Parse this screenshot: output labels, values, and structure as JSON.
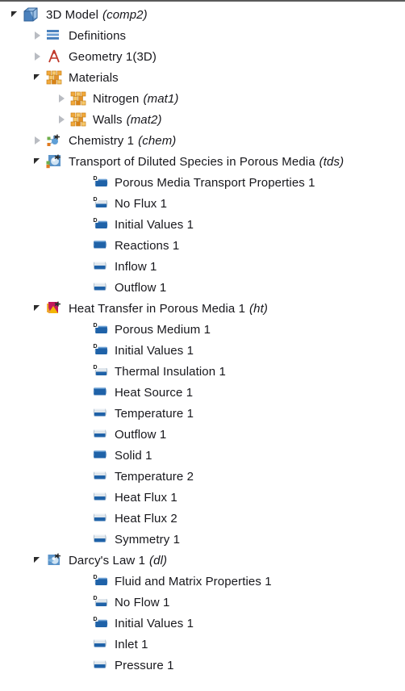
{
  "tree": {
    "title": "3D Model",
    "rows": [
      {
        "label": "3D Model",
        "tag": "(comp2)",
        "indent": 0,
        "expander": "open",
        "icon": "cube-3d-icon"
      },
      {
        "label": "Definitions",
        "tag": "",
        "indent": 1,
        "expander": "closed",
        "icon": "definitions-icon"
      },
      {
        "label": "Geometry 1(3D)",
        "tag": "",
        "indent": 1,
        "expander": "closed",
        "icon": "geometry-compass-icon"
      },
      {
        "label": "Materials",
        "tag": "",
        "indent": 1,
        "expander": "open",
        "icon": "materials-grid-icon"
      },
      {
        "label": "Nitrogen",
        "tag": "(mat1)",
        "indent": 2,
        "expander": "closed",
        "icon": "material-grid-icon"
      },
      {
        "label": "Walls",
        "tag": "(mat2)",
        "indent": 2,
        "expander": "closed",
        "icon": "material-grid-icon"
      },
      {
        "label": "Chemistry 1",
        "tag": "(chem)",
        "indent": 1,
        "expander": "closed",
        "icon": "chemistry-icon"
      },
      {
        "label": "Transport of Diluted Species in Porous Media",
        "tag": "(tds)",
        "indent": 1,
        "expander": "open",
        "icon": "tds-physics-icon"
      },
      {
        "label": "Porous Media Transport Properties 1",
        "tag": "",
        "indent": 3,
        "expander": "none",
        "icon": "domain-default-icon"
      },
      {
        "label": "No Flux 1",
        "tag": "",
        "indent": 3,
        "expander": "none",
        "icon": "boundary-default-icon"
      },
      {
        "label": "Initial Values 1",
        "tag": "",
        "indent": 3,
        "expander": "none",
        "icon": "domain-default-icon"
      },
      {
        "label": "Reactions 1",
        "tag": "",
        "indent": 3,
        "expander": "none",
        "icon": "domain-icon"
      },
      {
        "label": "Inflow 1",
        "tag": "",
        "indent": 3,
        "expander": "none",
        "icon": "boundary-icon"
      },
      {
        "label": "Outflow 1",
        "tag": "",
        "indent": 3,
        "expander": "none",
        "icon": "boundary-icon"
      },
      {
        "label": "Heat Transfer in Porous Media 1",
        "tag": "(ht)",
        "indent": 1,
        "expander": "open",
        "icon": "heat-transfer-icon"
      },
      {
        "label": "Porous Medium 1",
        "tag": "",
        "indent": 3,
        "expander": "none",
        "icon": "domain-default-icon"
      },
      {
        "label": "Initial Values 1",
        "tag": "",
        "indent": 3,
        "expander": "none",
        "icon": "domain-default-icon"
      },
      {
        "label": "Thermal Insulation 1",
        "tag": "",
        "indent": 3,
        "expander": "none",
        "icon": "boundary-default-icon"
      },
      {
        "label": "Heat Source 1",
        "tag": "",
        "indent": 3,
        "expander": "none",
        "icon": "domain-icon"
      },
      {
        "label": "Temperature 1",
        "tag": "",
        "indent": 3,
        "expander": "none",
        "icon": "boundary-icon"
      },
      {
        "label": "Outflow 1",
        "tag": "",
        "indent": 3,
        "expander": "none",
        "icon": "boundary-icon"
      },
      {
        "label": "Solid 1",
        "tag": "",
        "indent": 3,
        "expander": "none",
        "icon": "domain-icon"
      },
      {
        "label": "Temperature 2",
        "tag": "",
        "indent": 3,
        "expander": "none",
        "icon": "boundary-icon"
      },
      {
        "label": "Heat Flux 1",
        "tag": "",
        "indent": 3,
        "expander": "none",
        "icon": "boundary-icon"
      },
      {
        "label": "Heat Flux 2",
        "tag": "",
        "indent": 3,
        "expander": "none",
        "icon": "boundary-icon"
      },
      {
        "label": "Symmetry 1",
        "tag": "",
        "indent": 3,
        "expander": "none",
        "icon": "boundary-icon"
      },
      {
        "label": "Darcy's Law 1",
        "tag": "(dl)",
        "indent": 1,
        "expander": "open",
        "icon": "darcy-law-icon"
      },
      {
        "label": "Fluid and Matrix Properties 1",
        "tag": "",
        "indent": 3,
        "expander": "none",
        "icon": "domain-default-icon"
      },
      {
        "label": "No Flow 1",
        "tag": "",
        "indent": 3,
        "expander": "none",
        "icon": "boundary-default-icon"
      },
      {
        "label": "Initial Values 1",
        "tag": "",
        "indent": 3,
        "expander": "none",
        "icon": "domain-default-icon"
      },
      {
        "label": "Inlet 1",
        "tag": "",
        "indent": 3,
        "expander": "none",
        "icon": "boundary-icon"
      },
      {
        "label": "Pressure 1",
        "tag": "",
        "indent": 3,
        "expander": "none",
        "icon": "boundary-icon"
      }
    ]
  },
  "colors": {
    "text": "#17171c",
    "domain_blue": "#1f62a8",
    "boundary_blue": "#2f6fb4",
    "material_orange": "#f0a41e",
    "geometry_red": "#c0392b",
    "heat_magenta": "#b8246b",
    "background": "#ffffff"
  }
}
